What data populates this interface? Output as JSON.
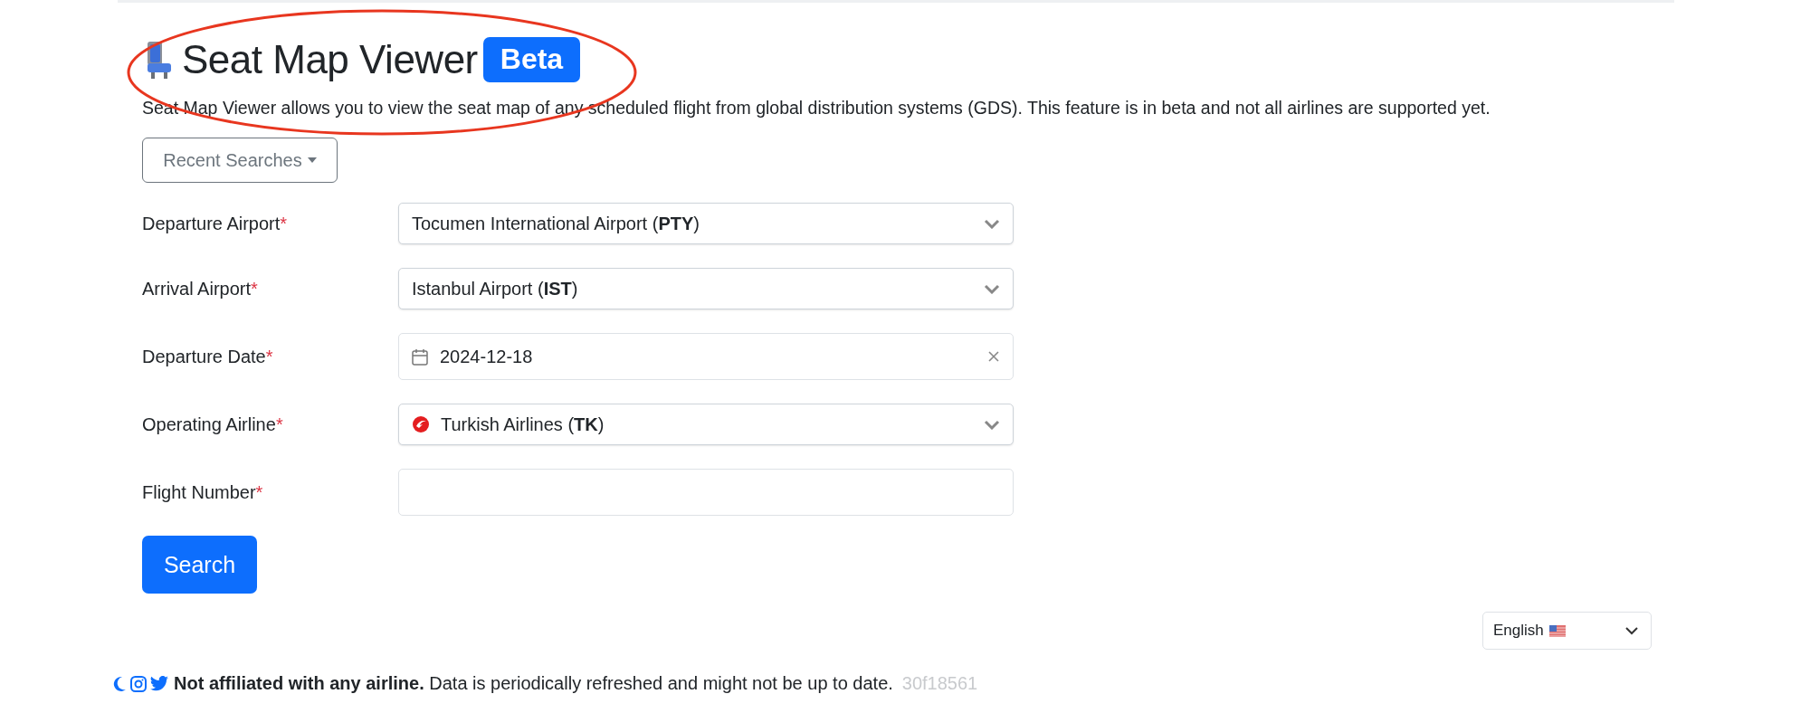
{
  "header": {
    "title": "Seat Map Viewer",
    "badge": "Beta",
    "description": "Seat Map Viewer allows you to view the seat map of any scheduled flight from global distribution systems (GDS). This feature is in beta and not all airlines are supported yet."
  },
  "recent_searches": {
    "label": "Recent Searches"
  },
  "fields": [
    {
      "kind": "select",
      "label": "Departure Airport",
      "required_mark": "*",
      "value": "Tocumen International Airport (**PTY**)"
    },
    {
      "kind": "select",
      "label": "Arrival Airport",
      "required_mark": "*",
      "value": "Istanbul Airport (**IST**)"
    },
    {
      "kind": "date",
      "label": "Departure Date",
      "required_mark": "*",
      "value": "2024-12-18"
    },
    {
      "kind": "airline",
      "label": "Operating Airline",
      "required_mark": "*",
      "value": "Turkish Airlines (**TK**)"
    },
    {
      "kind": "text",
      "label": "Flight Number",
      "required_mark": "*"
    }
  ],
  "search_button": "Search",
  "language": {
    "value": "English"
  },
  "footer": {
    "text": "**Not affiliated with any airline.** Data is periodically refreshed and might not be up to date.",
    "version": "30f18561"
  }
}
